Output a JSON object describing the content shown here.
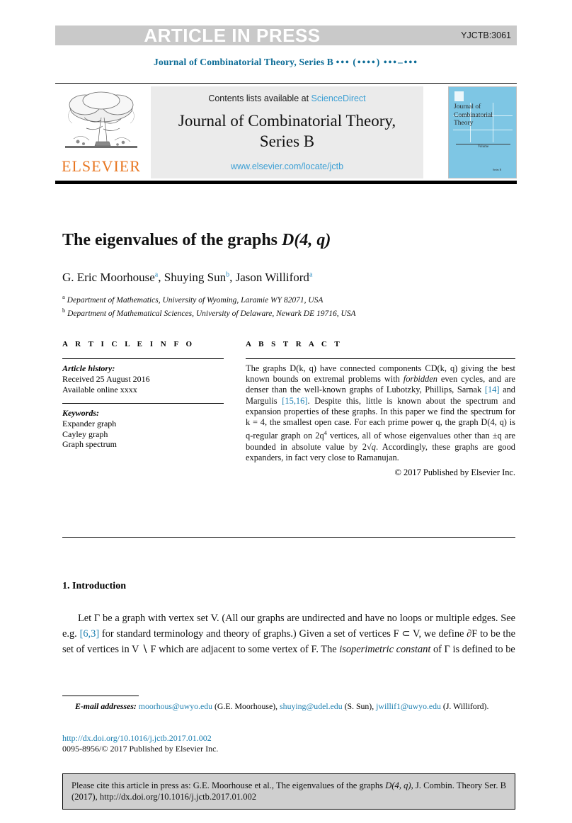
{
  "banner": {
    "press_label": "ARTICLE IN PRESS",
    "article_code": "YJCTB:3061",
    "banner_color": "#c9c9c9"
  },
  "running_head": {
    "journal": "Journal of Combinatorial Theory, Series B",
    "volume_dots": "•••",
    "year_dots": "(••••)",
    "pages_dots": "•••–•••",
    "color": "#0b6b96"
  },
  "masthead": {
    "publisher_name": "ELSEVIER",
    "publisher_color": "#e87722",
    "contents_prefix": "Contents lists available at",
    "contents_link": "ScienceDirect",
    "journal_title_line1": "Journal of Combinatorial Theory,",
    "journal_title_line2": "Series B",
    "journal_url": "www.elsevier.com/locate/jctb",
    "link_color": "#3b9fd4",
    "box_color": "#ebebeb",
    "cover": {
      "title_line1": "Journal of",
      "title_line2": "Combinatorial",
      "title_line3": "Theory",
      "volume_label": "Volume",
      "footer_text": "Series B",
      "color": "#7ec6e4"
    }
  },
  "article": {
    "title_text": "The eigenvalues of the graphs ",
    "title_math": "D(4, q)",
    "authors": [
      {
        "name": "G. Eric Moorhouse",
        "mark": "a"
      },
      {
        "name": "Shuying Sun",
        "mark": "b"
      },
      {
        "name": "Jason Williford",
        "mark": "a"
      }
    ],
    "affiliations": [
      {
        "mark": "a",
        "text": "Department of Mathematics, University of Wyoming, Laramie WY 82071, USA"
      },
      {
        "mark": "b",
        "text": "Department of Mathematical Sciences, University of Delaware, Newark DE 19716, USA"
      }
    ]
  },
  "info": {
    "heading": "A R T I C L E   I N F O",
    "history_label": "Article history:",
    "history_lines": [
      "Received 25 August 2016",
      "Available online xxxx"
    ],
    "keywords_label": "Keywords:",
    "keywords": [
      "Expander graph",
      "Cayley graph",
      "Graph spectrum"
    ]
  },
  "abstract": {
    "heading": "A B S T R A C T",
    "paragraph_parts": [
      "The graphs D(k, q) have connected components CD(k, q) giving the best known bounds on extremal problems with ",
      "forbidden",
      " even cycles, and are denser than the well-known graphs of Lubotzky, Phillips, Sarnak ",
      "[14]",
      " and Margulis ",
      "[15,16]",
      ". Despite this, little is known about the spectrum and expansion properties of these graphs. In this paper we find the spectrum for k = 4, the smallest open case. For each prime power q, the graph D(4, q) is q-regular graph on 2q",
      "4",
      " vertices, all of whose eigenvalues other than ±q are bounded in absolute value by 2",
      "√q",
      ". Accordingly, these graphs are good expanders, in fact very close to Ramanujan."
    ],
    "copyright": "© 2017 Published by Elsevier Inc.",
    "ref_color": "#1d7fb0"
  },
  "body": {
    "section_number": "1.",
    "section_title": "Introduction",
    "paragraph_parts": [
      "Let Γ be a graph with vertex set V. (All our graphs are undirected and have no loops or multiple edges. See e.g. ",
      "[6,3]",
      " for standard terminology and theory of graphs.) Given a set of vertices F ⊂ V, we define ∂F to be the set of vertices in V ∖ F which are adjacent to some vertex of F. The ",
      "isoperimetric constant",
      " of Γ is defined to be"
    ]
  },
  "footnote": {
    "email_label": "E-mail addresses:",
    "emails": [
      {
        "address": "moorhous@uwyo.edu",
        "owner": "(G.E. Moorhouse)"
      },
      {
        "address": "shuying@udel.edu",
        "owner": "(S. Sun)"
      },
      {
        "address": "jwillif1@uwyo.edu",
        "owner": "(J. Williford)"
      }
    ],
    "doi_url": "http://dx.doi.org/10.1016/j.jctb.2017.01.002",
    "issn_line": "0095-8956/© 2017 Published by Elsevier Inc.",
    "link_color": "#1d7fb0"
  },
  "cite_box": {
    "line1_a": "Please cite this article in press as: G.E. Moorhouse et al., The eigenvalues of the graphs ",
    "line1_math": "D(4, q)",
    "line1_b": ", J.",
    "line2": "Combin. Theory Ser. B (2017), http://dx.doi.org/10.1016/j.jctb.2017.01.002",
    "bg_color": "#cfcfcf"
  }
}
